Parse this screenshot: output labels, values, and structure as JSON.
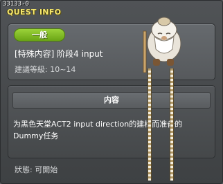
{
  "window": {
    "quest_id": "33133-0",
    "title": "QUEST INFO"
  },
  "summary": {
    "badge": "一般",
    "quest_name": "[特殊内容] 阶段4 input",
    "level_requirement": "建議等級: 10~14"
  },
  "content": {
    "header": "内容",
    "description": "为黑色天堂ACT2 input direction的建構而准备的Dummy任务"
  },
  "status": "狀態: 可開始",
  "colors": {
    "title": "#f7e96f",
    "badge": "#7ab92a",
    "panel": "#56595c"
  },
  "icons": {
    "npc": "old-sage-npc-sprite"
  }
}
